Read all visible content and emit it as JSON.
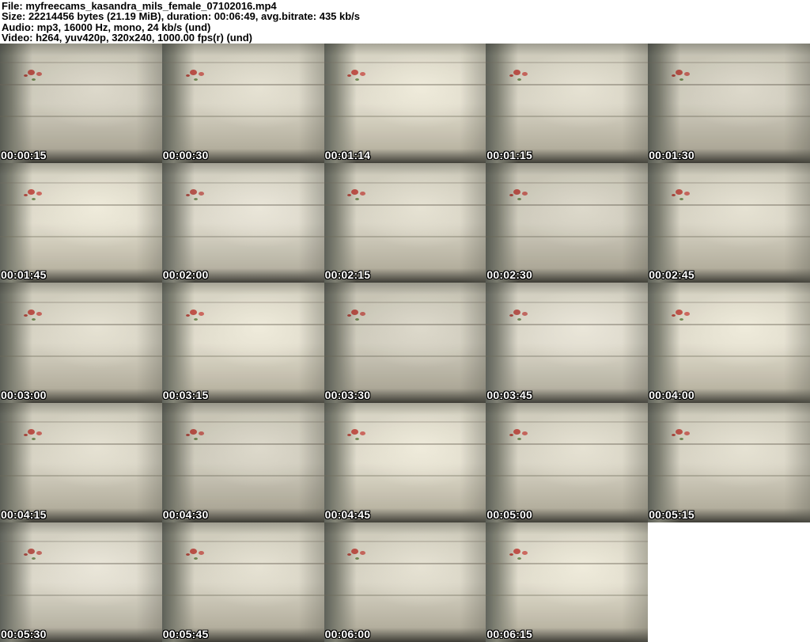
{
  "header": {
    "lines": [
      "File: myfreecams_kasandra_mils_female_07102016.mp4",
      "Size: 22214456 bytes (21.19 MiB), duration: 00:06:49, avg.bitrate: 435 kb/s",
      "Audio: mp3, 16000 Hz, mono, 24 kb/s (und)",
      "Video: h264, yuv420p, 320x240, 1000.00 fps(r) (und)"
    ]
  },
  "grid": {
    "columns": 5,
    "rows": 5,
    "thumbnail_count": 24
  },
  "thumbnails": [
    {
      "timestamp": "00:00:15"
    },
    {
      "timestamp": "00:00:30"
    },
    {
      "timestamp": "00:01:14"
    },
    {
      "timestamp": "00:01:15"
    },
    {
      "timestamp": "00:01:30"
    },
    {
      "timestamp": "00:01:45"
    },
    {
      "timestamp": "00:02:00"
    },
    {
      "timestamp": "00:02:15"
    },
    {
      "timestamp": "00:02:30"
    },
    {
      "timestamp": "00:02:45"
    },
    {
      "timestamp": "00:03:00"
    },
    {
      "timestamp": "00:03:15"
    },
    {
      "timestamp": "00:03:30"
    },
    {
      "timestamp": "00:03:45"
    },
    {
      "timestamp": "00:04:00"
    },
    {
      "timestamp": "00:04:15"
    },
    {
      "timestamp": "00:04:30"
    },
    {
      "timestamp": "00:04:45"
    },
    {
      "timestamp": "00:05:00"
    },
    {
      "timestamp": "00:05:15"
    },
    {
      "timestamp": "00:05:30"
    },
    {
      "timestamp": "00:05:45"
    },
    {
      "timestamp": "00:06:00"
    },
    {
      "timestamp": "00:06:15"
    }
  ],
  "colors": {
    "background": "#ffffff",
    "header_text": "#000000",
    "timestamp_text": "#ffffff",
    "timestamp_outline": "#000000",
    "scene_wall": "#d8d4c5",
    "scene_shadow": "#5d6058",
    "flower_accent": "#b43a32"
  }
}
